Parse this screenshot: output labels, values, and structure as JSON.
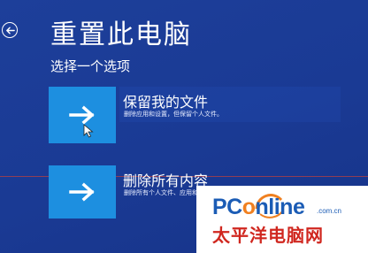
{
  "header": {
    "title": "重置此电脑",
    "subtitle": "选择一个选项"
  },
  "options": [
    {
      "title": "保留我的文件",
      "description": "删除应用和设置，但保留个人文件。"
    },
    {
      "title": "删除所有内容",
      "description": "删除所有个人文件、应用和设置。"
    }
  ],
  "watermark": {
    "logo_prefix": "PC",
    "logo_o": "o",
    "logo_suffix": "nline",
    "domain": ".com.cn",
    "name": "太平洋电脑网"
  },
  "icons": {
    "back": "back-arrow-icon",
    "option": "right-arrow-icon",
    "pointer": "mouse-pointer-icon"
  },
  "colors": {
    "background": "#1a3a94",
    "tile": "#1d8fe0",
    "watermark_blue": "#1b5cb5",
    "watermark_orange": "#f08020",
    "watermark_red": "#d0271f"
  }
}
